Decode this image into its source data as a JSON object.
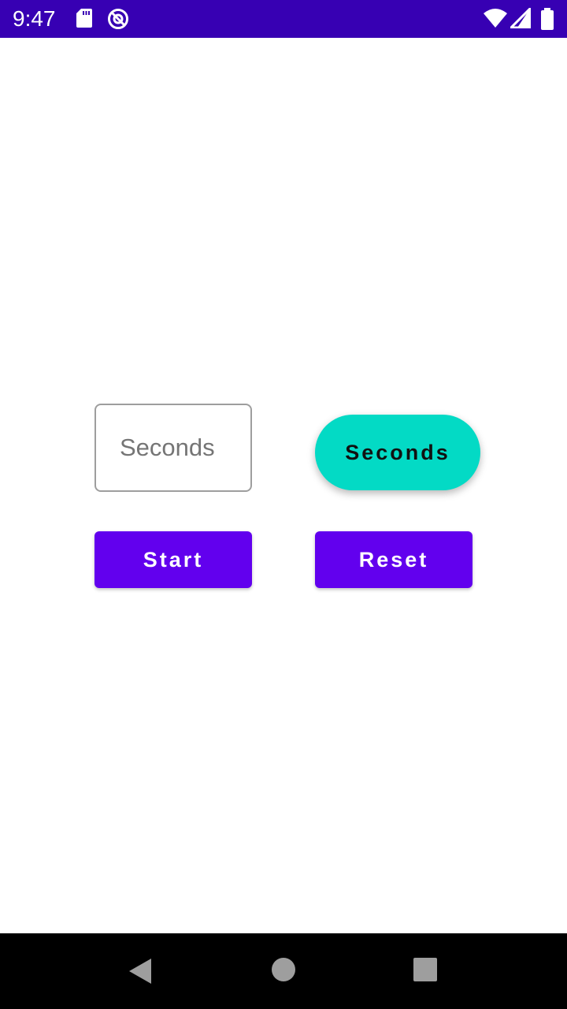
{
  "status_bar": {
    "time": "9:47",
    "background_color": "#3700b3",
    "icons": [
      "sd-card-icon",
      "sync-icon",
      "wifi-icon",
      "signal-icon",
      "battery-icon"
    ]
  },
  "form": {
    "seconds_input": {
      "placeholder": "Seconds",
      "value": ""
    },
    "seconds_display": {
      "label": "Seconds",
      "color": "#03dac5"
    }
  },
  "actions": {
    "start_label": "Start",
    "reset_label": "Reset",
    "color": "#6200ee"
  },
  "nav_bar": {
    "icons": [
      "back-icon",
      "home-icon",
      "recents-icon"
    ]
  }
}
